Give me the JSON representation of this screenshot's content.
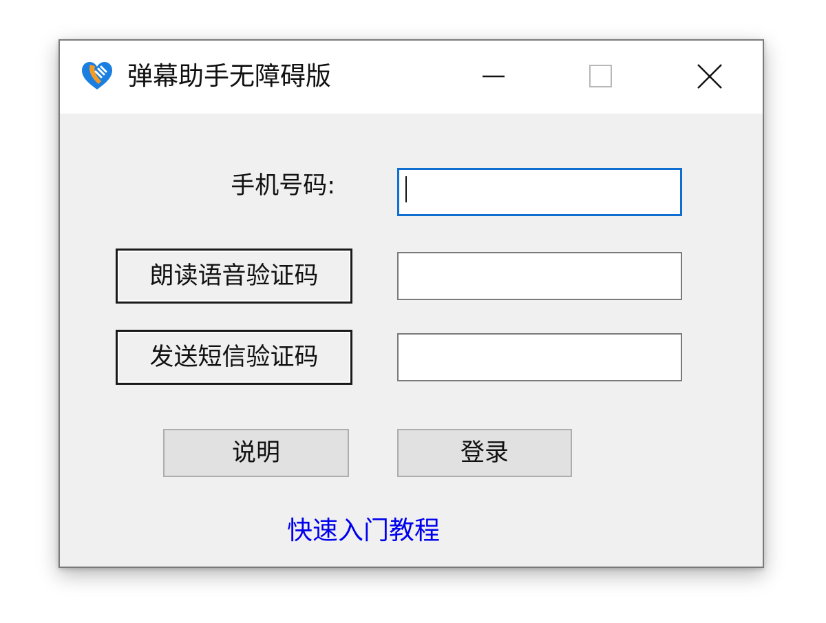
{
  "window": {
    "title": "弹幕助手无障碍版",
    "icon": "hands-heart-icon",
    "controls": {
      "minimize": "minimize-icon",
      "maximize": "maximize-icon",
      "close": "close-icon"
    }
  },
  "form": {
    "phone_label": "手机号码:",
    "phone_value": "",
    "voice_code_button": "朗读语音验证码",
    "voice_code_value": "",
    "sms_code_button": "发送短信验证码",
    "sms_code_value": ""
  },
  "actions": {
    "help_button": "说明",
    "login_button": "登录"
  },
  "footer": {
    "tutorial_link": "快速入门教程"
  },
  "colors": {
    "link": "#0000ee",
    "focus_border": "#0f6fd1",
    "icon_blue": "#1a7fe0",
    "icon_orange": "#f59a23"
  }
}
